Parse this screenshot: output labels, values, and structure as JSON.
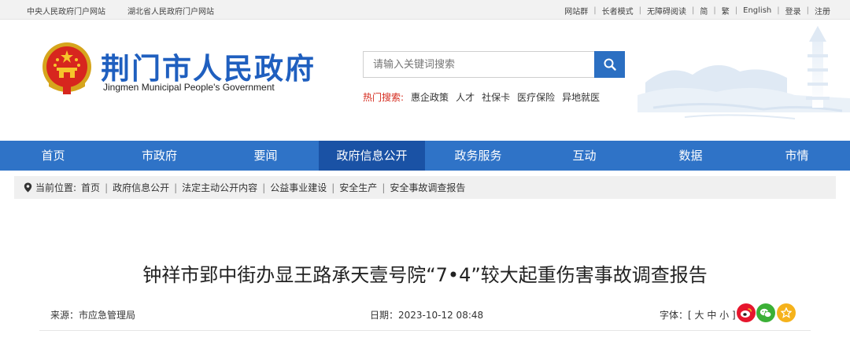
{
  "topbar": {
    "left_links": [
      "中央人民政府门户网站",
      "湖北省人民政府门户网站"
    ],
    "right_links": [
      "网站群",
      "长者模式",
      "无障碍阅读",
      "简",
      "繁",
      "English",
      "登录",
      "注册"
    ]
  },
  "header": {
    "title": "荆门市人民政府",
    "subtitle": "Jingmen Municipal People's Government",
    "search_placeholder": "请输入关键词搜索",
    "hot_label": "热门搜索:",
    "hot_items": [
      "惠企政策",
      "人才",
      "社保卡",
      "医疗保险",
      "异地就医"
    ]
  },
  "nav": {
    "items": [
      "首页",
      "市政府",
      "要闻",
      "政府信息公开",
      "政务服务",
      "互动",
      "数据",
      "市情"
    ],
    "active": "政府信息公开"
  },
  "breadcrumb": {
    "label": "当前位置:",
    "items": [
      "首页",
      "政府信息公开",
      "法定主动公开内容",
      "公益事业建设",
      "安全生产",
      "安全事故调查报告"
    ]
  },
  "article": {
    "title": "钟祥市郢中街办显王路承天壹号院“7•4”较大起重伤害事故调查报告",
    "source": "来源：市应急管理局",
    "date": "日期：2023-10-12 08:48",
    "font_label": "字体：",
    "font_options": "[ 大 中 小 ]"
  },
  "icons": {
    "search": "search-icon",
    "location": "location-pin-icon",
    "weibo": "weibo-icon",
    "wechat": "wechat-icon",
    "favorite": "star-icon"
  },
  "colors": {
    "brand_blue": "#1f5fbf",
    "nav_blue": "#2f73c7",
    "nav_active": "#1a52a5",
    "hot_red": "#d52b1e"
  }
}
